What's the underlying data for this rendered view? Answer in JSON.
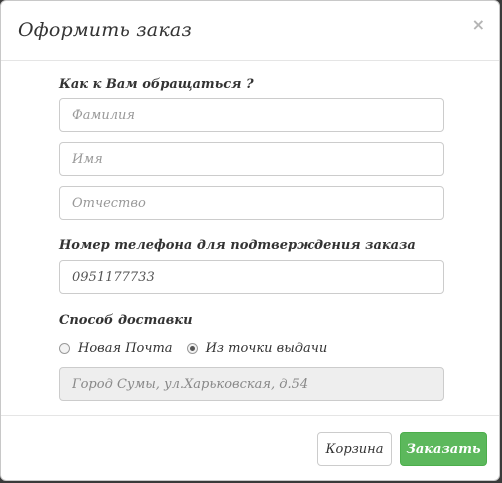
{
  "modal": {
    "title": "Оформить заказ",
    "close": "×"
  },
  "form": {
    "name_section_label": "Как к Вам обращаться ?",
    "last_name_placeholder": "Фамилия",
    "first_name_placeholder": "Имя",
    "middle_name_placeholder": "Отчество",
    "phone_label": "Номер телефона для подтверждения заказа",
    "phone_value": "0951177733",
    "delivery_label": "Способ доставки",
    "delivery_options": [
      {
        "label": "Новая Почта",
        "checked": false
      },
      {
        "label": "Из точки выдачи",
        "checked": true
      }
    ],
    "pickup_address_value": "Город Сумы, ул.Харьковская, д.54"
  },
  "footer": {
    "cart_button": "Корзина",
    "order_button": "Заказать"
  },
  "colors": {
    "success": "#5cb85c",
    "backdrop": "#3a3a3a"
  }
}
